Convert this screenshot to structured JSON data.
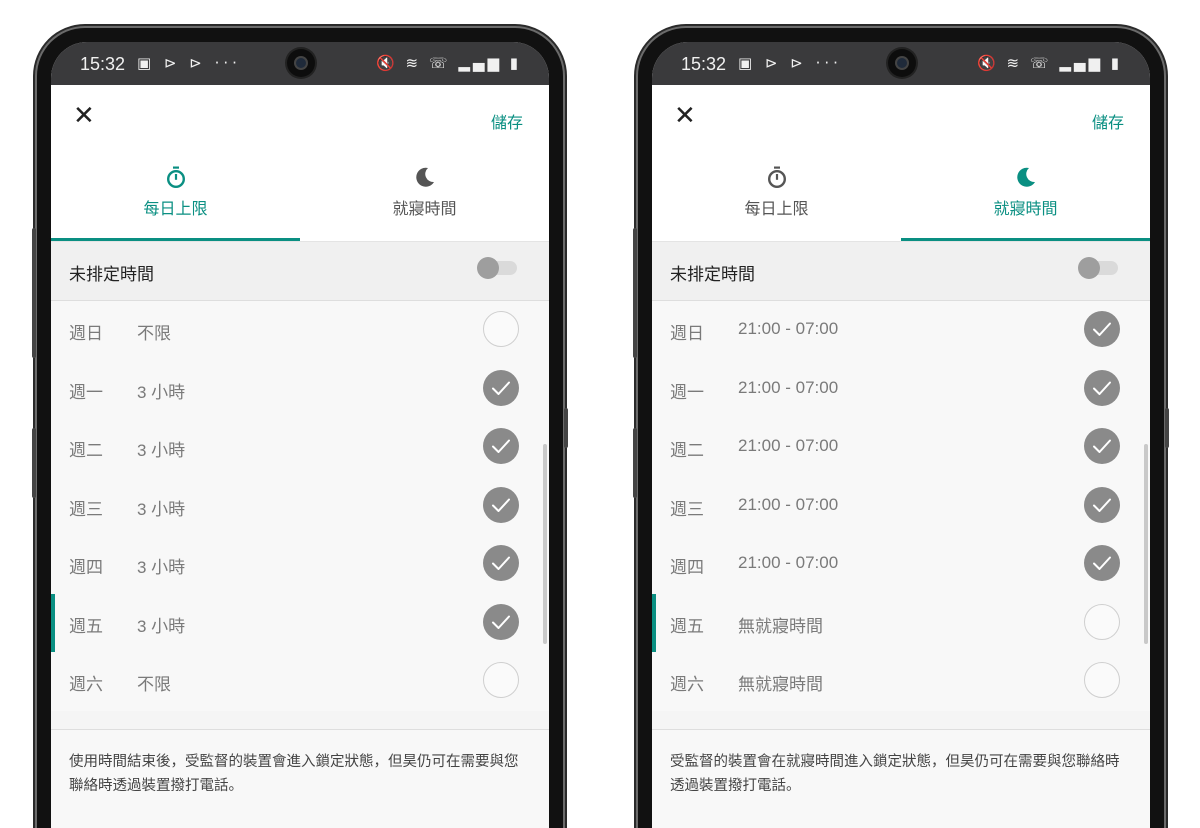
{
  "screens": [
    {
      "statusbar": {
        "time": "15:32",
        "notif_icons": "▣ ⊳ ⊳ ···",
        "sys_icons": "🔇 ≋ ☏ ▂▄▆ ▮"
      },
      "close_label": "✕",
      "save_label": "儲存",
      "tabs": [
        {
          "label": "每日上限",
          "icon": "timer-icon",
          "active": true
        },
        {
          "label": "就寢時間",
          "icon": "moon-icon",
          "active": false
        }
      ],
      "unscheduled_label": "未排定時間",
      "toggle_on": false,
      "days": [
        {
          "name": "週日",
          "value": "不限",
          "checked": false
        },
        {
          "name": "週一",
          "value": "3 小時",
          "checked": true
        },
        {
          "name": "週二",
          "value": "3 小時",
          "checked": true
        },
        {
          "name": "週三",
          "value": "3 小時",
          "checked": true
        },
        {
          "name": "週四",
          "value": "3 小時",
          "checked": true
        },
        {
          "name": "週五",
          "value": "3 小時",
          "checked": true,
          "today": true
        },
        {
          "name": "週六",
          "value": "不限",
          "checked": false
        }
      ],
      "note": "使用時間結束後，受監督的裝置會進入鎖定狀態，但昊仍可在需要與您聯絡時透過裝置撥打電話。"
    },
    {
      "statusbar": {
        "time": "15:32",
        "notif_icons": "▣ ⊳ ⊳ ···",
        "sys_icons": "🔇 ≋ ☏ ▂▄▆ ▮"
      },
      "close_label": "✕",
      "save_label": "儲存",
      "tabs": [
        {
          "label": "每日上限",
          "icon": "timer-icon",
          "active": false
        },
        {
          "label": "就寢時間",
          "icon": "moon-icon",
          "active": true
        }
      ],
      "unscheduled_label": "未排定時間",
      "toggle_on": false,
      "days": [
        {
          "name": "週日",
          "value": "21:00 - 07:00",
          "checked": true
        },
        {
          "name": "週一",
          "value": "21:00 - 07:00",
          "checked": true
        },
        {
          "name": "週二",
          "value": "21:00 - 07:00",
          "checked": true
        },
        {
          "name": "週三",
          "value": "21:00 - 07:00",
          "checked": true
        },
        {
          "name": "週四",
          "value": "21:00 - 07:00",
          "checked": true
        },
        {
          "name": "週五",
          "value": "無就寢時間",
          "checked": false,
          "today": true
        },
        {
          "name": "週六",
          "value": "無就寢時間",
          "checked": false
        }
      ],
      "note": "受監督的裝置會在就寢時間進入鎖定狀態，但昊仍可在需要與您聯絡時透過裝置撥打電話。"
    }
  ],
  "colors": {
    "accent": "#0a8f82",
    "check_on": "#8a8a8a",
    "statusbar": "#3a3a3c"
  }
}
